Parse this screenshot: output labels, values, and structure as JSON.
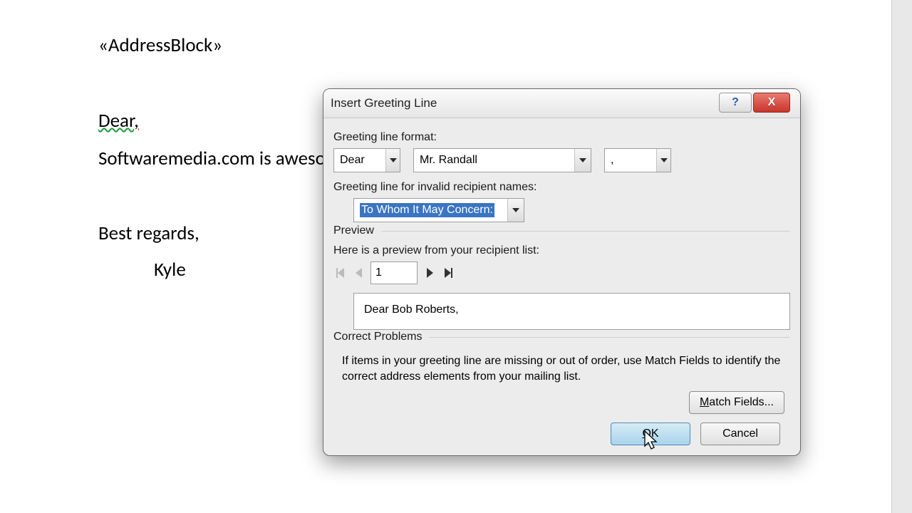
{
  "doc": {
    "addressBlock": "«AddressBlock»",
    "dear": "Dear",
    "line": "Softwaremedia.com is awesome.",
    "closing": "Best regards,",
    "signature": "Kyle"
  },
  "dlg": {
    "title": "Insert Greeting Line",
    "formatLbl": "Greeting line format:",
    "salutation": "Dear",
    "nameFormat": "Mr. Randall",
    "punct": ",",
    "invalidLbl": "Greeting line for invalid recipient names:",
    "invalidVal": "To Whom It May Concern:",
    "previewHdr": "Preview",
    "previewIntro": "Here is a preview from your recipient list:",
    "recordNum": "1",
    "previewText": "Dear Bob Roberts,",
    "correctHdr": "Correct Problems",
    "correctHelp": "If items in your greeting line are missing or out of order, use Match Fields to identify the correct address elements from your mailing list.",
    "matchBtn": "atch Fields...",
    "matchBtnU": "M",
    "okU": "O",
    "ok": "K",
    "cancel": "Cancel",
    "helpGlyph": "?",
    "closeGlyph": "X"
  }
}
